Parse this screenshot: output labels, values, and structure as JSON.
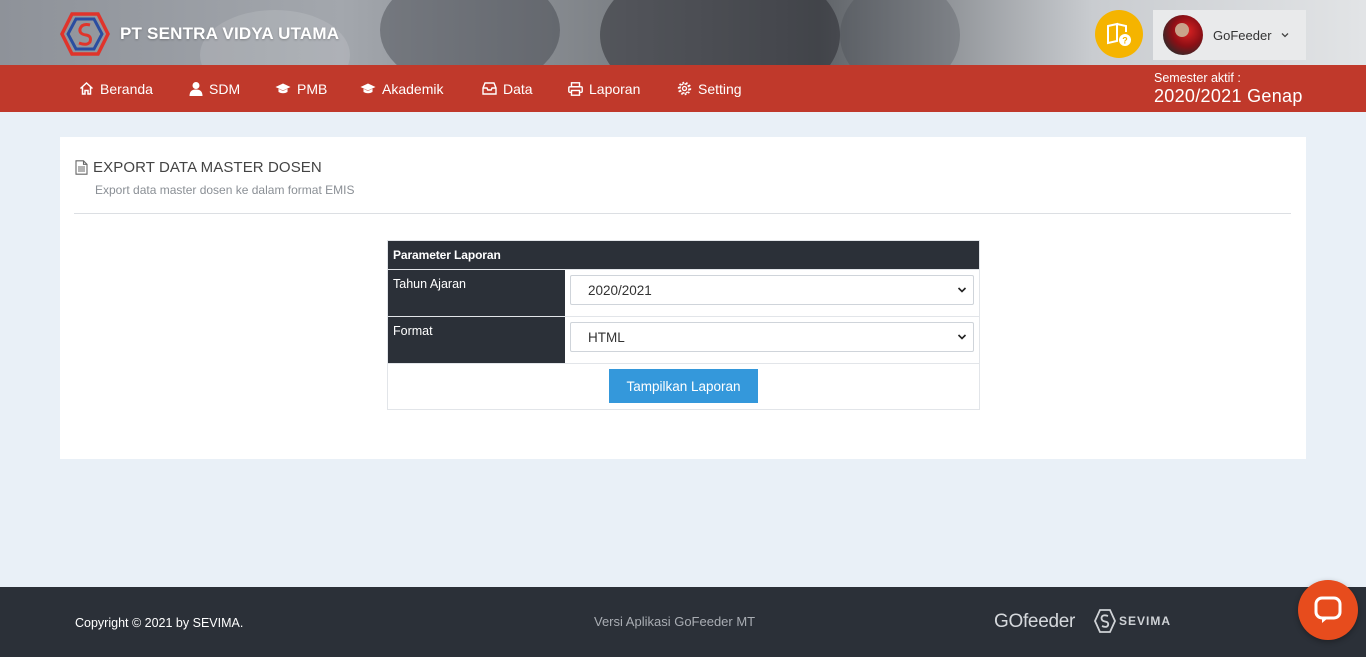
{
  "header": {
    "company_name": "PT SENTRA VIDYA UTAMA",
    "user_name": "GoFeeder"
  },
  "nav": {
    "items": [
      {
        "label": "Beranda",
        "icon": "home-icon"
      },
      {
        "label": "SDM",
        "icon": "user-icon"
      },
      {
        "label": "PMB",
        "icon": "graduation-cap-icon"
      },
      {
        "label": "Akademik",
        "icon": "graduation-cap-icon"
      },
      {
        "label": "Data",
        "icon": "inbox-icon"
      },
      {
        "label": "Laporan",
        "icon": "printer-icon"
      },
      {
        "label": "Setting",
        "icon": "gear-icon"
      }
    ],
    "semester_label": "Semester aktif :",
    "semester_value": "2020/2021 Genap"
  },
  "page": {
    "title": "EXPORT DATA MASTER DOSEN",
    "subtitle": "Export data master dosen ke dalam format EMIS"
  },
  "form": {
    "header": "Parameter Laporan",
    "fields": [
      {
        "label": "Tahun Ajaran",
        "value": "2020/2021"
      },
      {
        "label": "Format",
        "value": "HTML"
      }
    ],
    "submit_label": "Tampilkan Laporan"
  },
  "footer": {
    "copyright": "Copyright © 2021 by SEVIMA.",
    "version": "Versi Aplikasi GoFeeder MT",
    "logo_gofeeder": "GOfeeder",
    "logo_sevima": "SEVIMA"
  },
  "colors": {
    "nav_bg": "#c0392b",
    "dark": "#2b3038",
    "button": "#3498db",
    "help": "#f5b400",
    "chat": "#e74c1d"
  }
}
